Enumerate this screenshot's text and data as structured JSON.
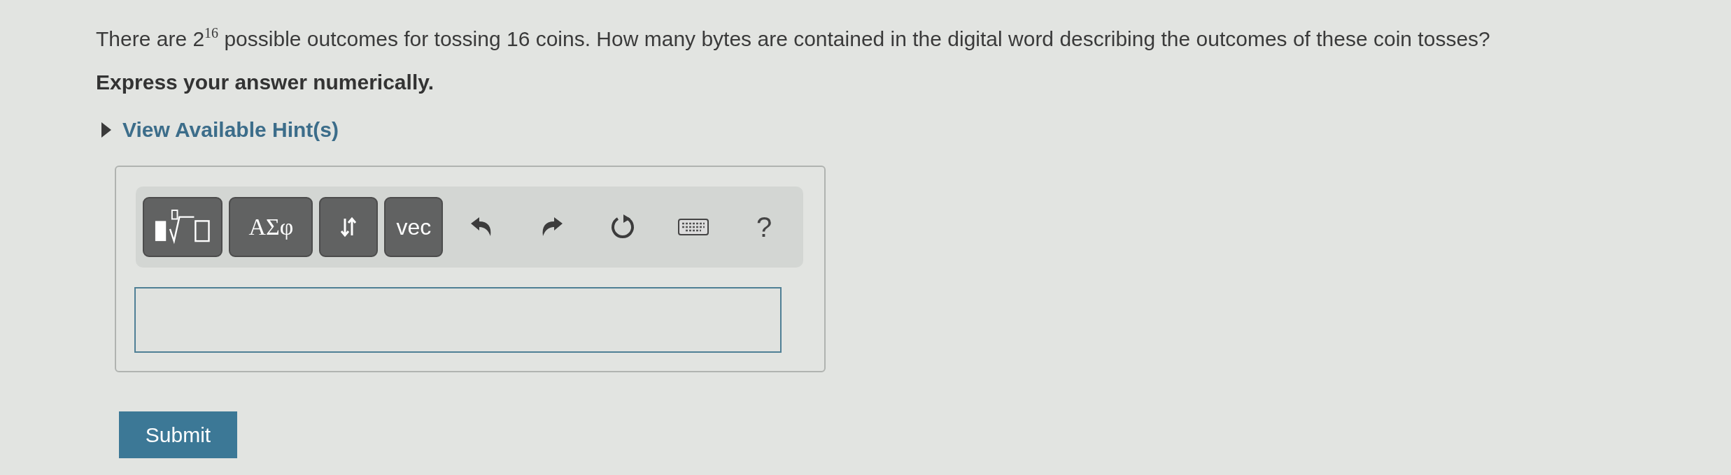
{
  "question": "There are 2$^{16}$ possible outcomes for tossing 16 coins. How many bytes are contained in the digital word describing the outcomes of these coin tosses?",
  "instruction": "Express your answer numerically.",
  "hints": {
    "label": "View Available Hint(s)",
    "expanded": false
  },
  "toolbar": [
    {
      "kind": "template"
    },
    {
      "kind": "label",
      "label": "ΑΣφ"
    },
    {
      "kind": "swap"
    },
    {
      "kind": "label",
      "label": "vec"
    },
    {
      "kind": "undo"
    },
    {
      "kind": "redo"
    },
    {
      "kind": "reset"
    },
    {
      "kind": "keyboard"
    },
    {
      "kind": "help",
      "label": "?"
    }
  ],
  "submit": {
    "label": "Submit"
  }
}
